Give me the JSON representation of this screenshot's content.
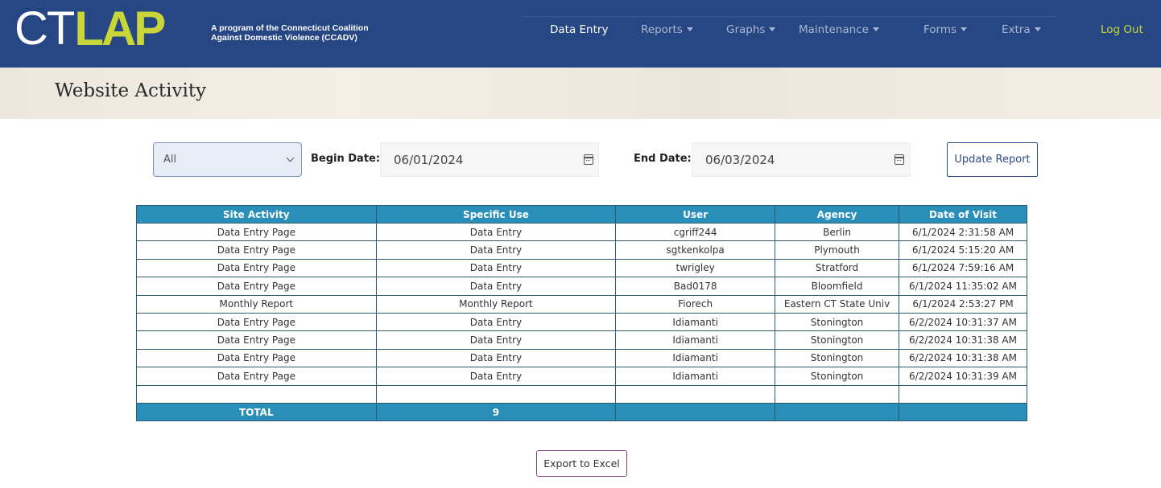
{
  "header": {
    "logo_ct": "CT",
    "logo_lap": "LAP",
    "tagline_line1": "A program of the Connecticut Coalition",
    "tagline_line2": "Against Domestic Violence (CCADV)",
    "nav": {
      "data_entry": "Data Entry",
      "reports": "Reports",
      "graphs": "Graphs",
      "maintenance": "Maintenance",
      "forms": "Forms",
      "extra": "Extra",
      "logout": "Log Out"
    }
  },
  "page": {
    "title": "Website Activity"
  },
  "filters": {
    "select_value": "All",
    "begin_label": "Begin Date:",
    "begin_value": "06/01/2024",
    "end_label": "End Date:",
    "end_value": "06/03/2024",
    "update_label": "Update Report"
  },
  "table": {
    "headers": [
      "Site Activity",
      "Specific Use",
      "User",
      "Agency",
      "Date of Visit"
    ],
    "rows": [
      [
        "Data Entry Page",
        "Data Entry",
        "cgriff244",
        "Berlin",
        "6/1/2024 2:31:58 AM"
      ],
      [
        "Data Entry Page",
        "Data Entry",
        "sgtkenkolpa",
        "Plymouth",
        "6/1/2024 5:15:20 AM"
      ],
      [
        "Data Entry Page",
        "Data Entry",
        "twrigley",
        "Stratford",
        "6/1/2024 7:59:16 AM"
      ],
      [
        "Data Entry Page",
        "Data Entry",
        "Bad0178",
        "Bloomfield",
        "6/1/2024 11:35:02 AM"
      ],
      [
        "Monthly Report",
        "Monthly Report",
        "Fiorech",
        "Eastern CT State Univ",
        "6/1/2024 2:53:27 PM"
      ],
      [
        "Data Entry Page",
        "Data Entry",
        "Idiamanti",
        "Stonington",
        "6/2/2024 10:31:37 AM"
      ],
      [
        "Data Entry Page",
        "Data Entry",
        "Idiamanti",
        "Stonington",
        "6/2/2024 10:31:38 AM"
      ],
      [
        "Data Entry Page",
        "Data Entry",
        "Idiamanti",
        "Stonington",
        "6/2/2024 10:31:38 AM"
      ],
      [
        "Data Entry Page",
        "Data Entry",
        "Idiamanti",
        "Stonington",
        "6/2/2024 10:31:39 AM"
      ]
    ],
    "total_label": "TOTAL",
    "total_value": "9"
  },
  "export_label": "Export to Excel",
  "icons": {
    "select_chevron": "chevron-down-icon",
    "calendar": "calendar-icon",
    "nav_caret": "caret-down-icon"
  },
  "colors": {
    "navbar": "#274684",
    "logo_accent": "#c8d63a",
    "table_header": "#2a8fb8"
  }
}
